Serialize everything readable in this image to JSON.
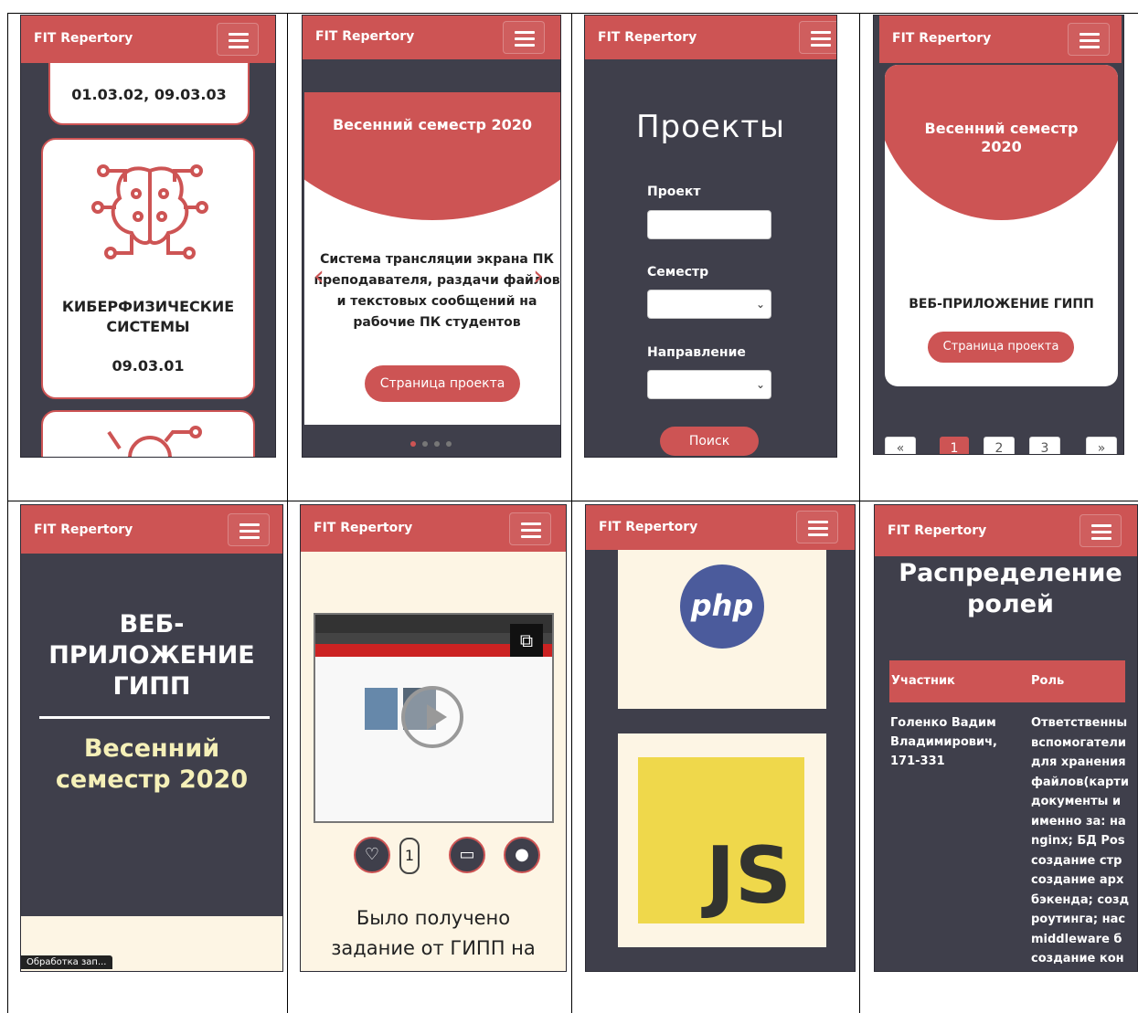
{
  "brand": "FIT Repertory",
  "screen1": {
    "top_code": "01.03.02, 09.03.03",
    "card_title": "КИБЕРФИЗИЧЕСКИЕ СИСТЕМЫ",
    "card_code": "09.03.01"
  },
  "screen2": {
    "semester": "Весенний семестр 2020",
    "description": "Система трансляции экрана ПК преподавателя, раздачи файлов и текстовых сообщений на рабочие ПК студентов",
    "button": "Страница проекта"
  },
  "screen3": {
    "heading": "Проекты",
    "label_project": "Проект",
    "label_semester": "Семестр",
    "label_direction": "Направление",
    "search_button": "Поиск"
  },
  "screen4": {
    "semester": "Весенний семестр 2020",
    "project_title": "ВЕБ-ПРИЛОЖЕНИЕ ГИПП",
    "button": "Страница проекта",
    "pagination": [
      "«",
      "1",
      "2",
      "3",
      "»"
    ]
  },
  "screen5": {
    "title": "ВЕБ-ПРИЛОЖЕНИЕ ГИПП",
    "semester": "Весенний семестр 2020",
    "status": "Обработка зап..."
  },
  "screen6": {
    "like_count": "1",
    "text": "Было получено задание от ГИПП на"
  },
  "screen7": {
    "php_label": "php",
    "js_label": "JS"
  },
  "screen8": {
    "heading": "Распределение ролей",
    "col_member": "Участник",
    "col_role": "Роль",
    "member": "Голенко Вадим Владимирович, 171-331",
    "role_lines": [
      "Ответственны",
      "вспомогатели",
      "для хранения",
      "файлов(карти",
      "документы и",
      "именно за: на",
      "nginx; БД Pos",
      "создание стр",
      "создание арх",
      "бэкенда; созд",
      "роутинга; нас",
      "middleware б",
      "создание кон"
    ]
  },
  "colors": {
    "accent": "#cd5454",
    "dark": "#3f3f4b",
    "cream": "#fdf5e4",
    "yellow": "#f5f0b8"
  }
}
